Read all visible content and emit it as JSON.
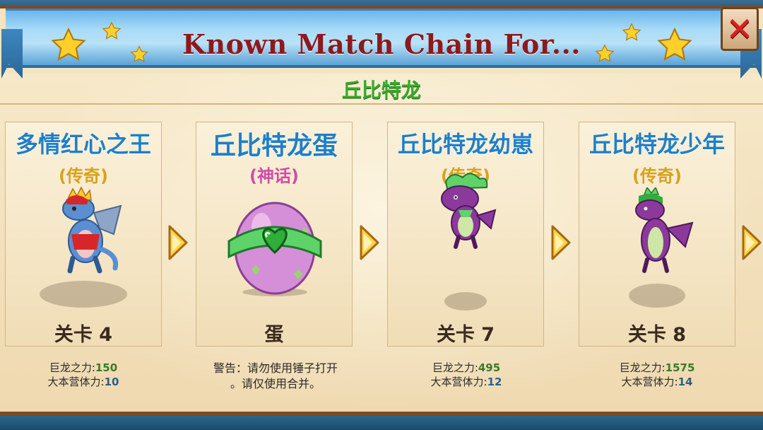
{
  "dialog": {
    "title": "Known Match Chain For...",
    "subtitle": "丘比特龙",
    "close_icon": "close-x-icon"
  },
  "cards": [
    {
      "name": "多情红心之王",
      "rarity": "(传奇)",
      "rarity_color": "#d8a21e",
      "level": "关卡 4",
      "image": "dragon-red-crown-icon",
      "stats": {
        "power_label": "巨龙之力:",
        "power": "150",
        "stamina_label": "大本营体力:",
        "stamina": "10"
      }
    },
    {
      "name": "丘比特龙蛋",
      "rarity": "(神话)",
      "rarity_color": "#d24ca6",
      "level": "蛋",
      "image": "cupid-egg-icon",
      "warning": {
        "line1": "警告：请勿使用锤子打开",
        "line2": "。请仅使用合并。"
      }
    },
    {
      "name": "丘比特龙幼崽",
      "rarity": "(传奇)",
      "rarity_color": "#d8a21e",
      "level": "关卡 7",
      "image": "baby-dragon-green-icon",
      "stats": {
        "power_label": "巨龙之力:",
        "power": "495",
        "stamina_label": "大本营体力:",
        "stamina": "12"
      }
    },
    {
      "name": "丘比特龙少年",
      "rarity": "(传奇)",
      "rarity_color": "#d8a21e",
      "level": "关卡 8",
      "image": "teen-dragon-green-icon",
      "stats": {
        "power_label": "巨龙之力:",
        "power": "1575",
        "stamina_label": "大本营体力:",
        "stamina": "14"
      }
    }
  ],
  "colors": {
    "title": "#8b1a1f",
    "subtitle": "#3aaa2a",
    "card_name": "#1f7fc8",
    "banner": "#a9dbf8"
  }
}
